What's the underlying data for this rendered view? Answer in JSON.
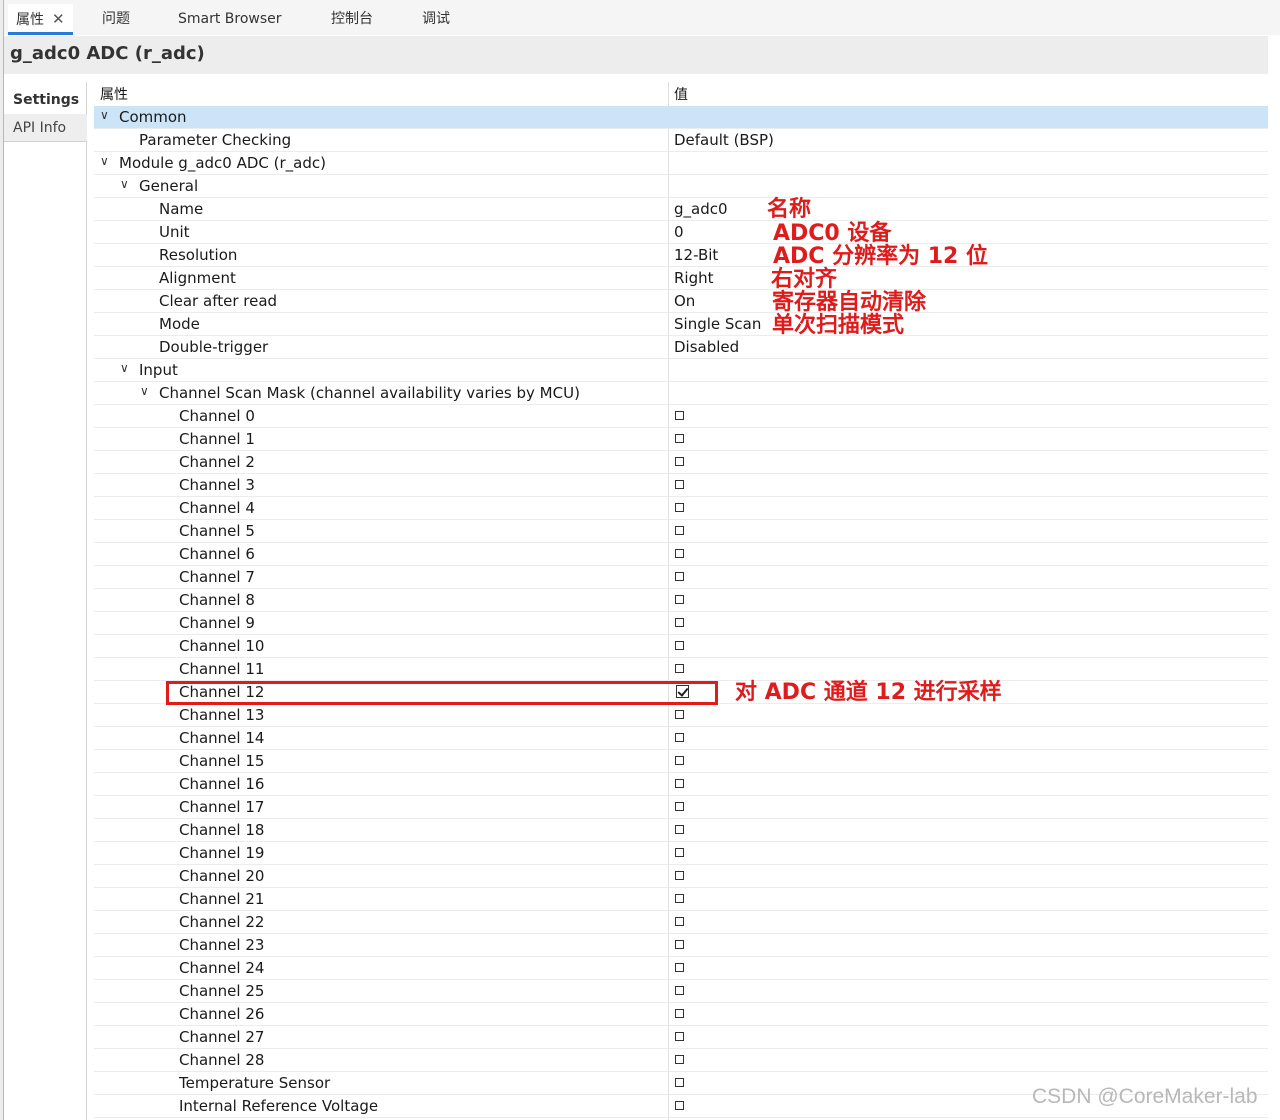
{
  "tabs": [
    "属性",
    "问题",
    "Smart Browser",
    "控制台",
    "调试"
  ],
  "title": "g_adc0 ADC (r_adc)",
  "side_tabs": {
    "settings": "Settings",
    "api_info": "API Info"
  },
  "columns": {
    "property": "属性",
    "value": "值"
  },
  "rows": {
    "common": "Common",
    "param_checking": "Parameter Checking",
    "param_checking_value": "Default (BSP)",
    "module": "Module g_adc0 ADC (r_adc)",
    "general": "General",
    "name": "Name",
    "name_value": "g_adc0",
    "unit": "Unit",
    "unit_value": "0",
    "resolution": "Resolution",
    "resolution_value": "12-Bit",
    "alignment": "Alignment",
    "alignment_value": "Right",
    "clear_after_read": "Clear after read",
    "clear_after_read_value": "On",
    "mode": "Mode",
    "mode_value": "Single Scan",
    "double_trigger": "Double-trigger",
    "double_trigger_value": "Disabled",
    "input": "Input",
    "channel_scan_mask": "Channel Scan Mask (channel availability varies by MCU)"
  },
  "channels": [
    {
      "label": "Channel 0",
      "checked": false
    },
    {
      "label": "Channel 1",
      "checked": false
    },
    {
      "label": "Channel 2",
      "checked": false
    },
    {
      "label": "Channel 3",
      "checked": false
    },
    {
      "label": "Channel 4",
      "checked": false
    },
    {
      "label": "Channel 5",
      "checked": false
    },
    {
      "label": "Channel 6",
      "checked": false
    },
    {
      "label": "Channel 7",
      "checked": false
    },
    {
      "label": "Channel 8",
      "checked": false
    },
    {
      "label": "Channel 9",
      "checked": false
    },
    {
      "label": "Channel 10",
      "checked": false
    },
    {
      "label": "Channel 11",
      "checked": false
    },
    {
      "label": "Channel 12",
      "checked": true
    },
    {
      "label": "Channel 13",
      "checked": false
    },
    {
      "label": "Channel 14",
      "checked": false
    },
    {
      "label": "Channel 15",
      "checked": false
    },
    {
      "label": "Channel 16",
      "checked": false
    },
    {
      "label": "Channel 17",
      "checked": false
    },
    {
      "label": "Channel 18",
      "checked": false
    },
    {
      "label": "Channel 19",
      "checked": false
    },
    {
      "label": "Channel 20",
      "checked": false
    },
    {
      "label": "Channel 21",
      "checked": false
    },
    {
      "label": "Channel 22",
      "checked": false
    },
    {
      "label": "Channel 23",
      "checked": false
    },
    {
      "label": "Channel 24",
      "checked": false
    },
    {
      "label": "Channel 25",
      "checked": false
    },
    {
      "label": "Channel 26",
      "checked": false
    },
    {
      "label": "Channel 27",
      "checked": false
    },
    {
      "label": "Channel 28",
      "checked": false
    },
    {
      "label": "Temperature Sensor",
      "checked": false
    },
    {
      "label": "Internal Reference Voltage",
      "checked": false
    }
  ],
  "annotations": {
    "name": "名称",
    "unit": "ADC0 设备",
    "resolution": "ADC 分辨率为 12 位",
    "alignment": "右对齐",
    "clear": "寄存器自动清除",
    "mode": "单次扫描模式",
    "channel12": "对 ADC 通道 12 进行采样"
  },
  "watermark": "CSDN @CoreMaker-lab",
  "colors": {
    "annotation": "#e01b1b",
    "selection": "#cce4f7",
    "tab_accent": "#2a7bd5"
  }
}
